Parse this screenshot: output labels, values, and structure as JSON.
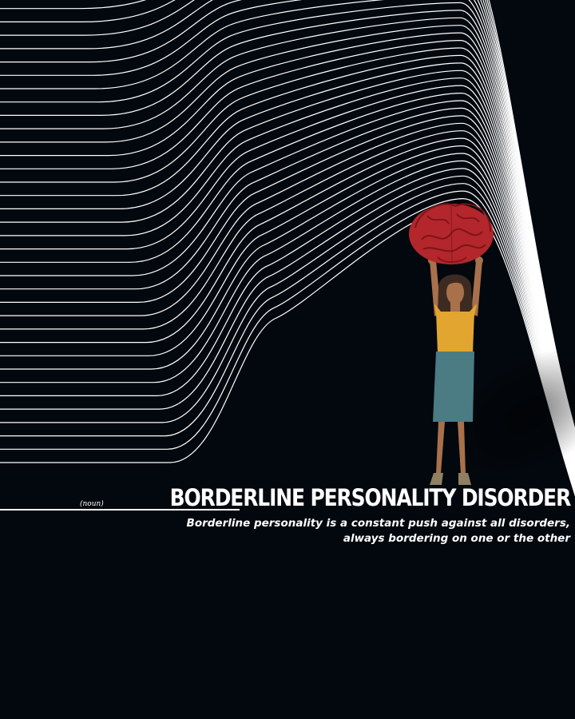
{
  "definition": {
    "part_of_speech": "(noun)",
    "title": "BORDERLINE PERSONALITY DISORDER",
    "line1": "Borderline personality is a constant push against all disorders,",
    "line2": "always bordering on one or the other"
  },
  "colors": {
    "background": "#03080e",
    "lines": "#ffffff",
    "brain": "#b3262b",
    "shirt": "#e2a530",
    "skirt": "#4b7b83",
    "skin": "#a8714b",
    "hair": "#3d2b22"
  }
}
